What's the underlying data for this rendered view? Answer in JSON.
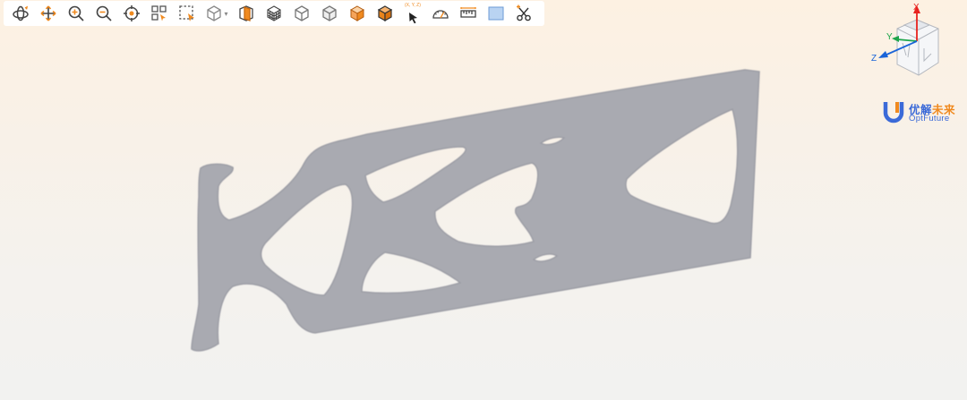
{
  "toolbar": {
    "buttons": [
      {
        "name": "rotate-button",
        "icon": "rotate-icon"
      },
      {
        "name": "pan-button",
        "icon": "pan-icon"
      },
      {
        "name": "zoom-in-button",
        "icon": "zoom-in-icon"
      },
      {
        "name": "zoom-out-button",
        "icon": "zoom-out-icon"
      },
      {
        "name": "zoom-to-fit-button",
        "icon": "target-icon"
      },
      {
        "name": "zoom-window-button",
        "icon": "zoom-window-icon"
      },
      {
        "name": "box-select-button",
        "icon": "box-select-icon"
      },
      {
        "name": "view-orientation-button",
        "icon": "cube-dropdown-icon"
      },
      {
        "name": "section-plane-button",
        "icon": "section-plane-icon"
      },
      {
        "name": "wireframe-button",
        "icon": "wireframe-cube-icon"
      },
      {
        "name": "hidden-line-button",
        "icon": "outline-cube-icon"
      },
      {
        "name": "shaded-edges-button",
        "icon": "shaded-edge-cube-icon"
      },
      {
        "name": "shaded-button",
        "icon": "orange-cube-icon"
      },
      {
        "name": "shaded-solid-button",
        "icon": "solid-orange-cube-icon"
      },
      {
        "name": "pick-point-button",
        "icon": "coordinate-pointer-icon"
      },
      {
        "name": "measure-angle-button",
        "icon": "protractor-icon"
      },
      {
        "name": "measure-distance-button",
        "icon": "ruler-icon"
      },
      {
        "name": "background-button",
        "icon": "blue-rectangle-icon"
      },
      {
        "name": "clip-button",
        "icon": "scissors-icon"
      }
    ],
    "pick_label": "(X, Y, Z)",
    "dropdown_glyph": "▾"
  },
  "triad": {
    "x_label": "X",
    "y_label": "Y",
    "z_label": "Z"
  },
  "logo": {
    "cn_main": "优解",
    "cn_accent": "未来",
    "en": "OptFuture"
  },
  "colors": {
    "accent_orange": "#f08a1f",
    "toolbar_icon": "#444444",
    "model_fill": "#a9aab1",
    "axis_x": "#e8231f",
    "axis_y": "#1ea54b",
    "axis_z": "#1a64d8",
    "logo_blue": "#3b6ad8"
  }
}
